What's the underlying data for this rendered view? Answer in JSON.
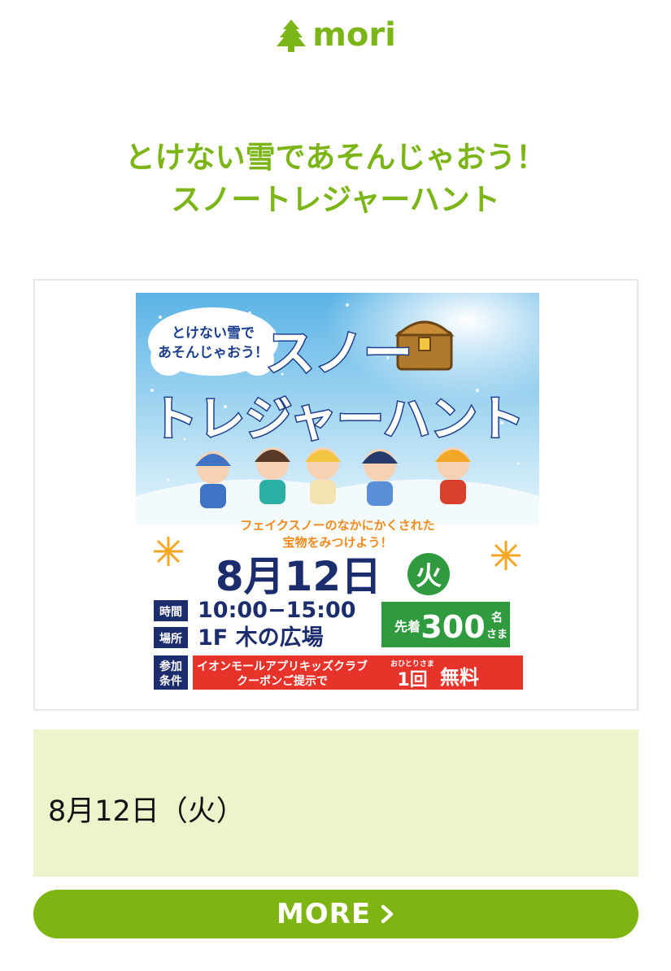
{
  "header": {
    "brand": "mori",
    "logo_icon": "tree-icon",
    "accent": "#7cb518"
  },
  "title": {
    "line1": "とけない雪であそんじゃおう！",
    "line2": "スノートレジャーハント"
  },
  "poster": {
    "bubble_line1": "とけない雪で",
    "bubble_line2": "あそんじゃおう！",
    "heading1": "スノー",
    "heading2": "トレジャーハント",
    "sub1": "フェイクスノーのなかにかくされた",
    "sub2": "宝物をみつけよう！",
    "date": "8月12日",
    "weekday": "火",
    "time_label": "時間",
    "time_value": "10:00−15:00",
    "place_label": "場所",
    "place_value": "1F 木の広場",
    "first_label": "先着",
    "capacity": "300",
    "capacity_unit1": "名",
    "capacity_unit2": "さま",
    "cond_label1": "参加",
    "cond_label2": "条件",
    "cond_text1": "イオンモールアプリキッズクラブ",
    "cond_text2": "クーポンご提示で",
    "per_person": "おひとりさま",
    "free_count": "1回",
    "free_label": "無料"
  },
  "info": {
    "date": "8月12日（火）",
    "background": "#eff3cc"
  },
  "more_button": {
    "label": "MORE",
    "icon": "chevron-right-icon",
    "color": "#7fb512"
  }
}
